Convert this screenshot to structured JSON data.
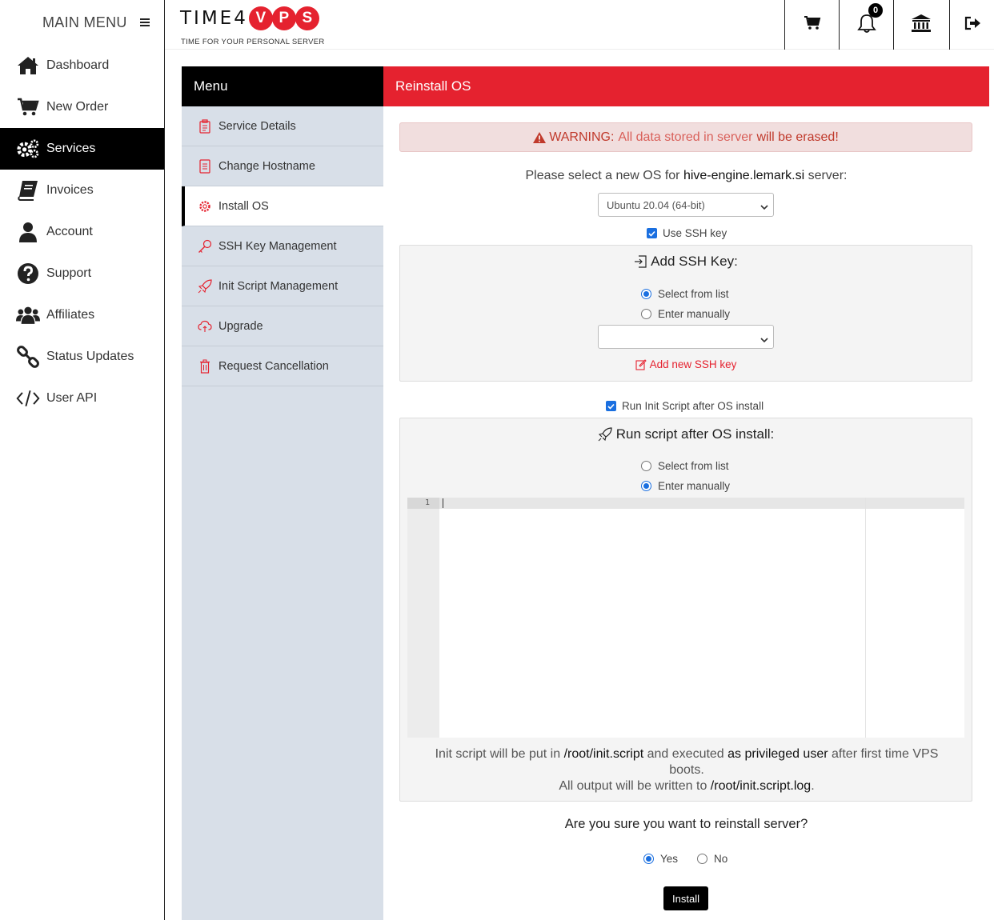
{
  "sidebar": {
    "title": "MAIN MENU",
    "items": [
      {
        "label": "Dashboard",
        "icon": "home-icon"
      },
      {
        "label": "New Order",
        "icon": "cart-icon"
      },
      {
        "label": "Services",
        "icon": "gears-icon",
        "active": true
      },
      {
        "label": "Invoices",
        "icon": "book-icon"
      },
      {
        "label": "Account",
        "icon": "user-icon"
      },
      {
        "label": "Support",
        "icon": "question-icon"
      },
      {
        "label": "Affiliates",
        "icon": "users-icon"
      },
      {
        "label": "Status Updates",
        "icon": "link-icon"
      },
      {
        "label": "User API",
        "icon": "code-icon"
      }
    ]
  },
  "header": {
    "logo_text": "TIME4",
    "logo_letters": [
      "V",
      "P",
      "S"
    ],
    "tagline": "TIME FOR YOUR PERSONAL SERVER",
    "notification_count": "0",
    "buttons": [
      "cart-icon",
      "bell-icon",
      "bank-icon",
      "logout-icon"
    ]
  },
  "service_menu": {
    "title": "Menu",
    "items": [
      {
        "label": "Service Details",
        "icon": "clipboard-icon"
      },
      {
        "label": "Change Hostname",
        "icon": "document-icon"
      },
      {
        "label": "Install OS",
        "icon": "gear-icon",
        "active": true
      },
      {
        "label": "SSH Key Management",
        "icon": "key-icon"
      },
      {
        "label": "Init Script Management",
        "icon": "rocket-icon"
      },
      {
        "label": "Upgrade",
        "icon": "cloud-icon"
      },
      {
        "label": "Request Cancellation",
        "icon": "trash-icon"
      }
    ]
  },
  "reinstall": {
    "title": "Reinstall OS",
    "warning_prefix": "WARNING:",
    "warning_middle1": "All data stored in server",
    "warning_strong": "will be erased!",
    "select_prefix": "Please select a new OS for",
    "hostname": "hive-engine.lemark.si",
    "select_suffix": "server:",
    "os_selected": "Ubuntu 20.04 (64-bit)",
    "use_ssh_label": "Use SSH key",
    "ssh_box_title": "Add SSH Key:",
    "ssh_radio_list": "Select from list",
    "ssh_radio_manual": "Enter manually",
    "add_new_key": "Add new SSH key",
    "run_init_label": "Run Init Script after OS install",
    "script_box_title": "Run script after OS install:",
    "script_radio_list": "Select from list",
    "script_radio_manual": "Enter manually",
    "editor_line": "1",
    "note_1": "Init script will be put in",
    "note_path1": "/root/init.script",
    "note_2": "and executed",
    "note_priv": "as privileged user",
    "note_3": "after first time VPS boots.",
    "note_4": "All output will be written to",
    "note_path2": "/root/init.script.log",
    "note_5": ".",
    "confirm_question": "Are you sure you want to reinstall server?",
    "yes_label": "Yes",
    "no_label": "No",
    "install_button": "Install"
  },
  "colors": {
    "brand_red": "#e5222f",
    "menu_bg": "#d8dfe8",
    "check_blue": "#1a6fe0"
  }
}
